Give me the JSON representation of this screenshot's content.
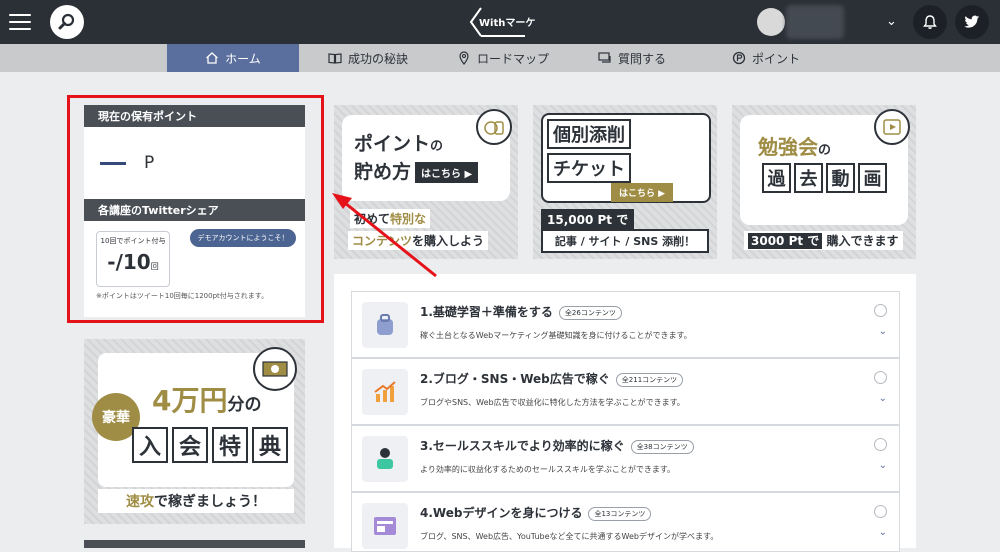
{
  "header": {
    "logo_text": "Withマーケ"
  },
  "nav": {
    "tabs": [
      {
        "label": "ホーム",
        "active": true
      },
      {
        "label": "成功の秘訣",
        "active": false
      },
      {
        "label": "ロードマップ",
        "active": false
      },
      {
        "label": "質問する",
        "active": false
      },
      {
        "label": "ポイント",
        "active": false
      }
    ]
  },
  "points_card": {
    "title": "現在の保有ポイント",
    "unit": "P",
    "share_title": "各講座のTwitterシェア",
    "count_caption": "10回でポイント付与",
    "count_value": "-/10",
    "count_unit": "回",
    "bubble": "デモアカウントにようこそ！",
    "note": "※ポイントはツイート10回毎に1200pt付与されます。"
  },
  "left_banner": {
    "badge": "豪華",
    "amount": "4万円",
    "amount_suffix": "分の",
    "kanji": [
      "入",
      "会",
      "特",
      "典"
    ],
    "footer_gold": "速攻",
    "footer_rest": "で稼ぎましょう！"
  },
  "tiles": {
    "t1": {
      "line1a": "ポイント",
      "line1b": "の",
      "line2": "貯め方",
      "pill": "はこちら ▶",
      "foot1a": "初めて",
      "foot1b": "特別な",
      "foot2a": "コンテンツ",
      "foot2b": "を購入しよう"
    },
    "t2": {
      "line1": "個別添削",
      "line2": "チケット",
      "pill": "はこちら ▶",
      "pts": "15,000 Pt で",
      "foot": "記事 / サイト / SNS 添削！"
    },
    "t3": {
      "line1a": "勉強会",
      "line1b": "の",
      "kanji": [
        "過",
        "去",
        "動",
        "画"
      ],
      "pts": "3000 Pt で",
      "foot": "購入できます"
    }
  },
  "courses": [
    {
      "title": "1.基礎学習＋準備をする",
      "badge": "全26コンテンツ",
      "desc": "稼ぐ土台となるWebマーケティング基礎知識を身に付けることができます。",
      "icon": "backpack-icon"
    },
    {
      "title": "2.ブログ・SNS・Web広告で稼ぐ",
      "badge": "全211コンテンツ",
      "desc": "ブログやSNS、Web広告で収益化に特化した方法を学ぶことができます。",
      "icon": "growth-chart-icon"
    },
    {
      "title": "3.セールススキルでより効率的に稼ぐ",
      "badge": "全38コンテンツ",
      "desc": "より効率的に収益化するためのセールススキルを学ぶことができます。",
      "icon": "sales-person-icon"
    },
    {
      "title": "4.Webデザインを身につける",
      "badge": "全13コンテンツ",
      "desc": "ブログ、SNS、Web広告、YouTubeなど全てに共通するWebデザインが学べます。",
      "icon": "web-design-icon"
    }
  ],
  "colors": {
    "header_bg": "#2b3037",
    "nav_active": "#5a6f9d",
    "gold": "#a08d45",
    "highlight_red": "#e5121a"
  }
}
